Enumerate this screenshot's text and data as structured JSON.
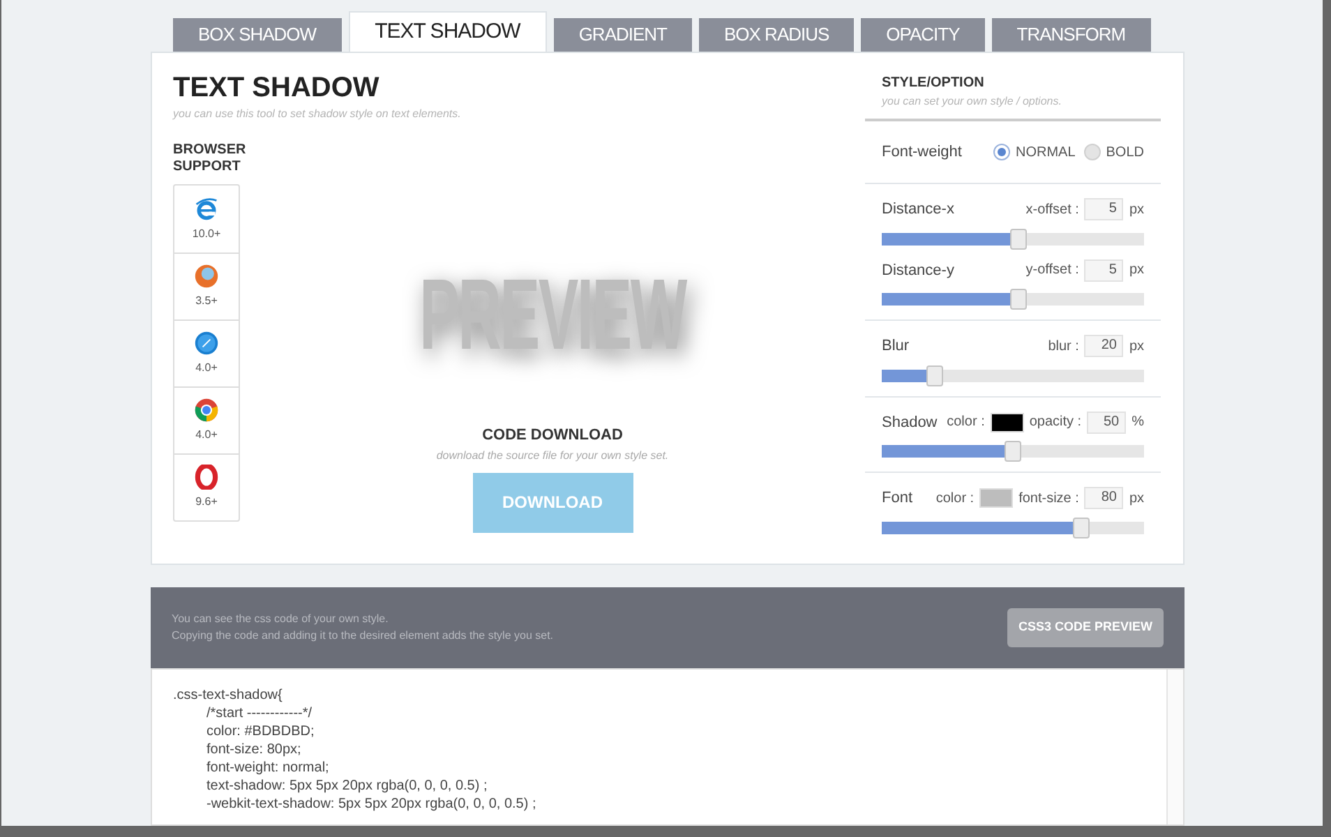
{
  "tabs": [
    {
      "label": "BOX SHADOW",
      "selected": false
    },
    {
      "label": "TEXT SHADOW",
      "selected": true
    },
    {
      "label": "GRADIENT",
      "selected": false
    },
    {
      "label": "BOX RADIUS",
      "selected": false
    },
    {
      "label": "OPACITY",
      "selected": false
    },
    {
      "label": "TRANSFORM",
      "selected": false
    }
  ],
  "tool": {
    "title": "TEXT SHADOW",
    "subtitle": "you can use this tool to set shadow style on text elements.",
    "browser_support": {
      "title": "BROWSER SUPPORT",
      "browsers": [
        {
          "kind": "ie",
          "version": "10.0+"
        },
        {
          "kind": "firefox",
          "version": "3.5+"
        },
        {
          "kind": "safari",
          "version": "4.0+"
        },
        {
          "kind": "chrome",
          "version": "4.0+"
        },
        {
          "kind": "opera",
          "version": "9.6+"
        }
      ]
    },
    "preview": "PREVIEW",
    "download": {
      "title": "CODE DOWNLOAD",
      "subtitle": "download the source file for your own style set.",
      "button": "DOWNLOAD"
    }
  },
  "options": {
    "title": "STYLE/OPTION",
    "subtitle": "you can set your own style / options.",
    "groups": [
      {
        "kind": "radio",
        "label": "Font-weight",
        "choices": [
          {
            "label": "NORMAL",
            "selected": true
          },
          {
            "label": "BOLD",
            "selected": false
          }
        ]
      },
      {
        "kind": "sliders",
        "rows": [
          {
            "label": "Distance-x",
            "field_label": "x-offset :",
            "value": "5",
            "unit": "px",
            "level": 0.52
          },
          {
            "label": "Distance-y",
            "field_label": "y-offset :",
            "value": "5",
            "unit": "px",
            "level": 0.52
          }
        ]
      },
      {
        "kind": "sliders",
        "rows": [
          {
            "label": "Blur",
            "field_label": "blur :",
            "value": "20",
            "unit": "px",
            "level": 0.2
          }
        ]
      },
      {
        "kind": "sliders",
        "rows": [
          {
            "label": "Shadow",
            "color_label": "color :",
            "color": "#000000",
            "field_label": "opacity :",
            "value": "50",
            "unit": "%",
            "level": 0.5
          }
        ]
      },
      {
        "kind": "sliders",
        "rows": [
          {
            "label": "Font",
            "color_label": "color :",
            "color": "#bdbdbd",
            "field_label": "font-size :",
            "value": "80",
            "unit": "px",
            "level": 0.76
          }
        ]
      }
    ]
  },
  "code_panel": {
    "notes": [
      "You can see the css code of your own style.",
      "Copying the code and adding it to the desired element adds the style you set."
    ],
    "button": "CSS3 CODE PREVIEW",
    "code": {
      "selector": ".css-text-shadow{",
      "lines": [
        "/*start ------------*/",
        "color: #BDBDBD;",
        "font-size: 80px;",
        "font-weight: normal;",
        "text-shadow: 5px 5px 20px rgba(0, 0, 0, 0.5) ;",
        "-webkit-text-shadow: 5px 5px 20px rgba(0, 0, 0, 0.5) ;"
      ]
    }
  }
}
